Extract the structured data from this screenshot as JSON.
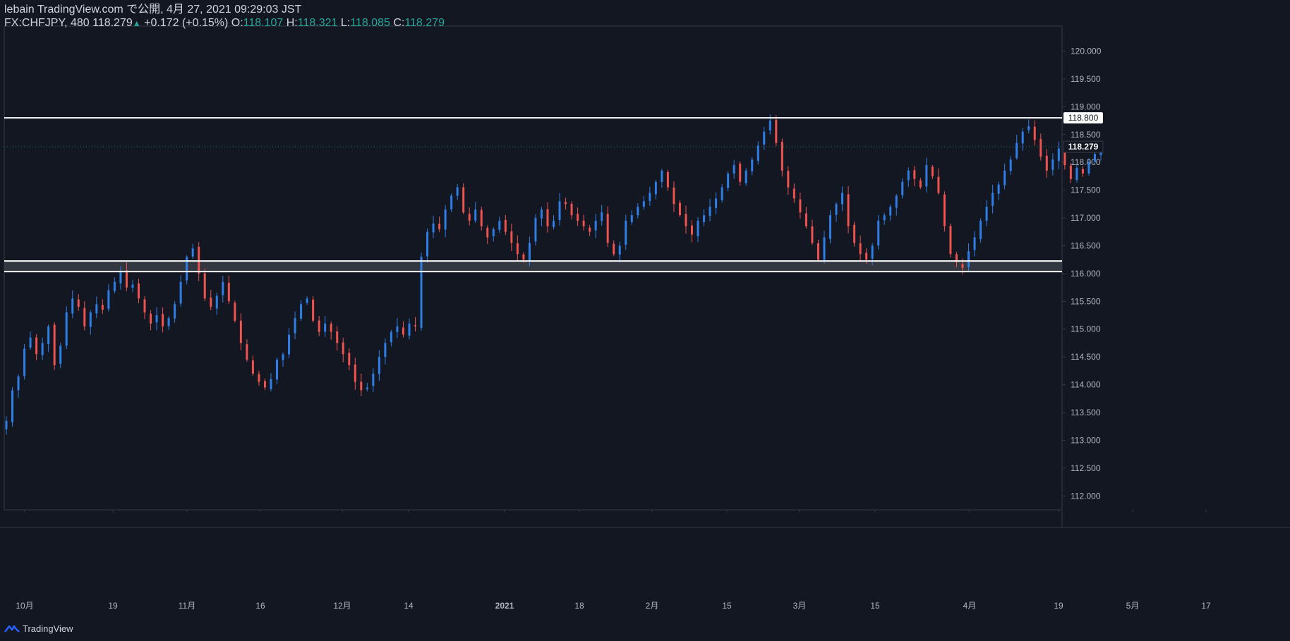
{
  "header": {
    "line1": "lebain TradingView.com で公開, 4月 27, 2021 09:29:03 JST",
    "symbol": "FX:CHFJPY, 480",
    "last": "118.279",
    "change_arrow": "▲",
    "change": "+0.172 (+0.15%)",
    "o_label": "O:",
    "o_value": "118.107",
    "h_label": "H:",
    "h_value": "118.321",
    "l_label": "L:",
    "l_value": "118.085",
    "c_label": "C:",
    "c_value": "118.279"
  },
  "brand": {
    "label": "TradingView",
    "icon": "tradingview-logo-icon"
  },
  "colors": {
    "background": "#131722",
    "up": "#2e7ee6",
    "down": "#ef5350",
    "line": "#ffffff",
    "grid": "#1e2230",
    "axis_text": "#b2b5be",
    "current_price": "#26a69a"
  },
  "chart_data": {
    "type": "candlestick",
    "y_axis": {
      "range": [
        111.75,
        120.45
      ],
      "ticks": [
        "112.000",
        "112.500",
        "113.000",
        "113.500",
        "114.000",
        "114.500",
        "115.000",
        "115.500",
        "116.000",
        "116.500",
        "117.000",
        "117.500",
        "118.000",
        "118.500",
        "119.000",
        "119.500",
        "120.000"
      ],
      "side": "right"
    },
    "x_axis": {
      "ticks": [
        "10月",
        "19",
        "11月",
        "16",
        "12月",
        "14",
        "2021",
        "18",
        "2月",
        "15",
        "3月",
        "15",
        "4月",
        "19",
        "5月",
        "17"
      ]
    },
    "last_price_label": "118.279",
    "horizontal_lines": [
      {
        "price": 118.8,
        "label": "118.800"
      },
      {
        "price": 116.225
      },
      {
        "price": 116.035
      }
    ],
    "support_zone": [
      116.035,
      116.225
    ],
    "approx_closes": [
      113.35,
      113.9,
      114.15,
      114.65,
      114.85,
      114.55,
      114.75,
      115.05,
      114.35,
      114.7,
      115.3,
      115.55,
      115.4,
      115.05,
      115.3,
      115.45,
      115.35,
      115.7,
      115.85,
      116.05,
      115.75,
      115.8,
      115.55,
      115.3,
      115.1,
      115.25,
      115.05,
      115.2,
      115.45,
      115.85,
      116.3,
      116.45,
      116.0,
      115.55,
      115.4,
      115.6,
      115.85,
      115.5,
      115.15,
      114.75,
      114.45,
      114.2,
      114.05,
      113.95,
      114.1,
      114.45,
      114.55,
      114.9,
      115.2,
      115.45,
      115.55,
      115.15,
      114.95,
      115.1,
      114.95,
      114.75,
      114.55,
      114.35,
      114.05,
      113.9,
      113.95,
      114.2,
      114.5,
      114.75,
      114.95,
      115.05,
      114.9,
      115.1,
      115.05,
      116.3,
      116.75,
      116.9,
      116.8,
      117.15,
      117.4,
      117.55,
      117.1,
      116.95,
      117.15,
      116.85,
      116.65,
      116.8,
      116.95,
      116.75,
      116.55,
      116.35,
      116.25,
      116.55,
      117.0,
      117.15,
      116.85,
      116.95,
      117.3,
      117.25,
      117.05,
      116.95,
      116.85,
      116.75,
      116.95,
      117.1,
      116.55,
      116.35,
      116.5,
      116.95,
      117.05,
      117.2,
      117.3,
      117.45,
      117.65,
      117.85,
      117.55,
      117.25,
      117.05,
      116.85,
      116.7,
      116.95,
      117.05,
      117.2,
      117.35,
      117.55,
      117.8,
      117.95,
      117.65,
      117.85,
      118.05,
      118.3,
      118.55,
      118.75,
      118.35,
      117.85,
      117.55,
      117.35,
      117.1,
      116.85,
      116.55,
      116.25,
      116.65,
      117.05,
      117.25,
      117.45,
      116.85,
      116.55,
      116.35,
      116.25,
      116.5,
      116.95,
      117.05,
      117.2,
      117.4,
      117.65,
      117.85,
      117.7,
      117.55,
      117.95,
      117.75,
      117.45,
      116.85,
      116.35,
      116.2,
      116.1,
      116.4,
      116.65,
      116.95,
      117.2,
      117.45,
      117.6,
      117.85,
      118.05,
      118.35,
      118.55,
      118.65,
      118.4,
      118.1,
      117.85,
      118.05,
      118.25,
      117.95,
      117.7,
      117.9,
      117.8,
      118.0,
      118.15,
      118.28
    ]
  }
}
